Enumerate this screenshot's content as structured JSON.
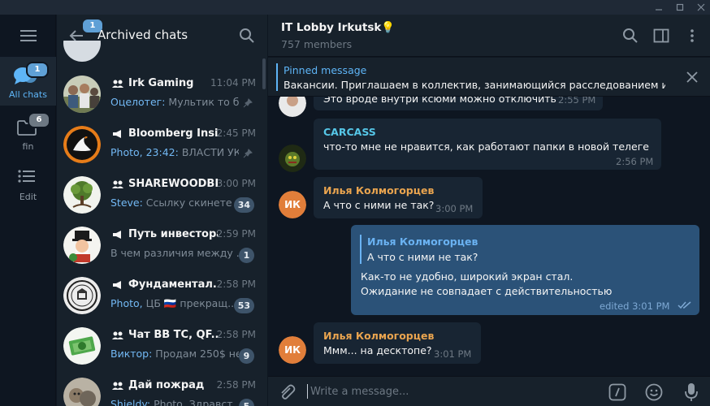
{
  "window": {
    "controls": [
      "minimize-icon",
      "maximize-icon",
      "close-icon"
    ]
  },
  "rail": {
    "menu_icon": "hamburger-icon",
    "folders": [
      {
        "label": "All chats",
        "badge": "1",
        "icon": "chat-bubbles-icon",
        "active": true
      },
      {
        "label": "fin",
        "badge": "6",
        "icon": "folder-icon",
        "active": false
      },
      {
        "label": "Edit",
        "badge": "",
        "icon": "edit-list-icon",
        "active": false
      }
    ]
  },
  "chat_list": {
    "back_badge": "1",
    "title": "Archived chats",
    "chats": [
      {
        "name": "Irk Gaming",
        "type": "group",
        "time": "11:04 PM",
        "sender": "Оцелотег:",
        "preview": " Мультик то б...",
        "pinned": true,
        "count": ""
      },
      {
        "name": "Bloomberg Insi...",
        "type": "channel",
        "time": "2:45 PM",
        "sender": "Photo, 23:42:",
        "preview": " ВЛАСТИ УК...",
        "pinned": true,
        "count": ""
      },
      {
        "name": "SHAREWOODBI...",
        "type": "group",
        "time": "3:00 PM",
        "sender": "Steve:",
        "preview": " Ссылку скинете ...",
        "pinned": false,
        "count": "34"
      },
      {
        "name": "Путь инвестора",
        "type": "channel",
        "time": "2:59 PM",
        "sender": "",
        "preview": "В чем различия между ...",
        "pinned": false,
        "count": "1"
      },
      {
        "name": "Фундаментал...",
        "type": "channel",
        "time": "2:58 PM",
        "sender": "Photo,",
        "preview": " ЦБ 🇷🇺 прекращ...",
        "pinned": false,
        "count": "53"
      },
      {
        "name": "Чат BB TC, QF...",
        "type": "group",
        "time": "2:58 PM",
        "sender": "Виктор:",
        "preview": " Продам 250$ не...",
        "pinned": false,
        "count": "9"
      },
      {
        "name": "Дай пожрад",
        "type": "group",
        "time": "2:58 PM",
        "sender": "Shieldy:",
        "preview": " Photo, Здравст...",
        "pinned": false,
        "count": "5"
      }
    ]
  },
  "chat": {
    "title": "IT Lobby Irkutsk💡",
    "subtitle": "757 members",
    "pinned_label": "Pinned message",
    "pinned_text": "Вакансии. Приглашаем в коллектив, занимающийся расследованием ин...",
    "composer_placeholder": "Write a message...",
    "messages": [
      {
        "text": "Это вроде внутри ксюми можно отключить",
        "time": "2:55 PM"
      },
      {
        "author": "CARCASS",
        "text": "что-то мне не нравится, как работают папки в новой телеге",
        "time": "2:56 PM"
      },
      {
        "author": "Илья Колмогорцев",
        "initials": "ИК",
        "text": "А что с ними не так?",
        "time": "3:00 PM"
      },
      {
        "reply_author": "Илья Колмогорцев",
        "reply_text": "А что с ними не так?",
        "line1": "Как-то не удобно, широкий экран стал.",
        "line2": "Ожидание не совпадает с действительностью",
        "time": "edited 3:01 PM"
      },
      {
        "author": "Илья Колмогорцев",
        "initials": "ИК",
        "text": "Ммм... на десктопе?",
        "time": "3:01 PM"
      }
    ]
  },
  "colors": {
    "accent": "#5eb5f7",
    "author_orange": "#e9a44f",
    "author_cyan": "#56c7e8",
    "outgoing_bubble": "#2b5278",
    "incoming_bubble": "#182533"
  }
}
